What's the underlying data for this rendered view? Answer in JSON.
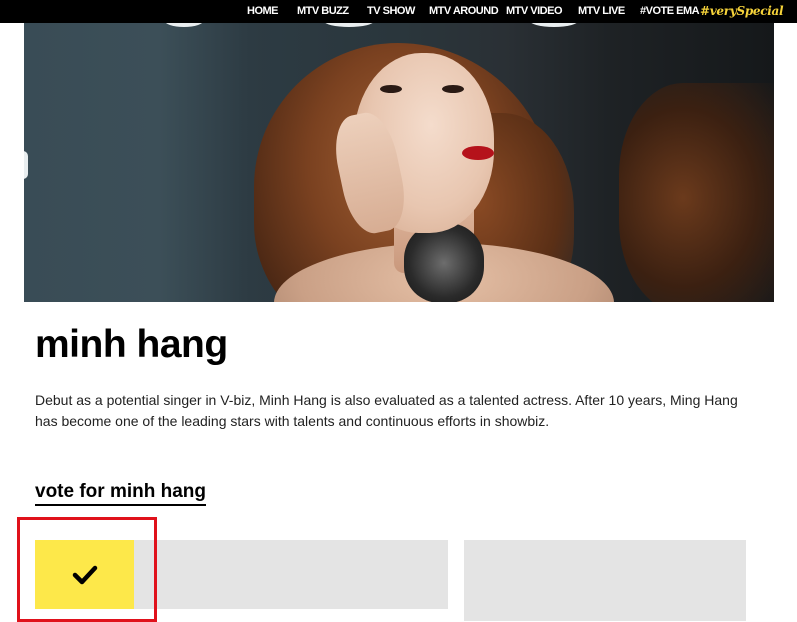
{
  "nav": {
    "items": [
      "HOME",
      "MTV BUZZ",
      "TV SHOW",
      "MTV AROUND",
      "MTV VIDEO",
      "MTV LIVE",
      "#VOTE EMA"
    ],
    "special": "#verySpecial"
  },
  "artist": {
    "name": "minh hang",
    "description": "Debut as a potential singer in V-biz, Minh Hang is also evaluated as a talented actress. After 10 years, Ming Hang has become one of the leading stars with talents and continuous efforts in showbiz.",
    "vote_label": "vote for minh hang"
  },
  "vote": {
    "check_icon": "checkmark-icon"
  },
  "colors": {
    "nav_bg": "#000000",
    "special_accent": "#f6d33a",
    "vote_accent": "#fde84a",
    "card_bg": "#e4e4e4",
    "highlight": "#e0111b"
  }
}
